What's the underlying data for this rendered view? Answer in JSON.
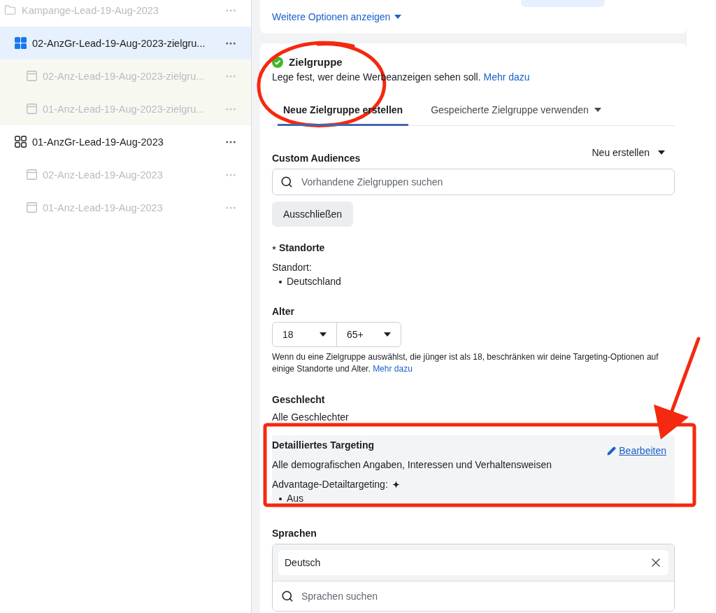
{
  "sidebar": {
    "items": [
      {
        "label": "Kampange-Lead-19-Aug-2023",
        "kind": "campaign",
        "selected": false,
        "dimmed": true,
        "children": [
          {
            "label": "02-AnzGr-Lead-19-Aug-2023-zielgru...",
            "kind": "adset",
            "selected": true,
            "dimmed": false,
            "children": [
              {
                "label": "02-Anz-Lead-19-Aug-2023-zielgru...",
                "kind": "ad",
                "selected": false,
                "dimmed": true
              },
              {
                "label": "01-Anz-Lead-19-Aug-2023-zielgru...",
                "kind": "ad",
                "selected": false,
                "dimmed": true
              }
            ]
          },
          {
            "label": "01-AnzGr-Lead-19-Aug-2023",
            "kind": "adset",
            "selected": false,
            "dimmed": false,
            "children": [
              {
                "label": "02-Anz-Lead-19-Aug-2023",
                "kind": "ad",
                "selected": false,
                "dimmed": true
              },
              {
                "label": "01-Anz-Lead-19-Aug-2023",
                "kind": "ad",
                "selected": false,
                "dimmed": true
              }
            ]
          }
        ]
      }
    ]
  },
  "more_options_link": "Weitere Optionen anzeigen",
  "audience": {
    "title": "Zielgruppe",
    "complete": true,
    "description": "Lege fest, wer deine Werbeanzeigen sehen soll.",
    "learn_more": "Mehr dazu",
    "tabs": [
      {
        "label": "Neue Zielgruppe erstellen",
        "selected": true,
        "dropdown": false
      },
      {
        "label": "Gespeicherte Zielgruppe verwenden",
        "selected": false,
        "dropdown": true
      }
    ],
    "custom_audiences": {
      "label": "Custom Audiences",
      "create_menu": "Neu erstellen",
      "search_placeholder": "Vorhandene Zielgruppen suchen",
      "exclude_button": "Ausschließen"
    },
    "locations": {
      "label": "Standorte",
      "required": true,
      "sublabel": "Standort:",
      "items": [
        "Deutschland"
      ]
    },
    "age": {
      "label": "Alter",
      "min": "18",
      "max": "65+",
      "note": "Wenn du eine Zielgruppe auswählst, die jünger ist als 18, beschränken wir deine Targeting-Optionen auf einige Standorte und Alter.",
      "note_link": "Mehr dazu"
    },
    "gender": {
      "label": "Geschlecht",
      "value": "Alle Geschlechter"
    },
    "detailed_targeting": {
      "label": "Detailliertes Targeting",
      "edit_link": "Bearbeiten",
      "summary": "Alle demografischen Angaben, Interessen und Verhaltensweisen",
      "advantage_label": "Advantage-Detailtargeting:",
      "advantage_items": [
        "Aus"
      ]
    },
    "languages": {
      "label": "Sprachen",
      "selected": [
        {
          "label": "Deutsch"
        }
      ],
      "search_placeholder": "Sprachen suchen"
    }
  }
}
